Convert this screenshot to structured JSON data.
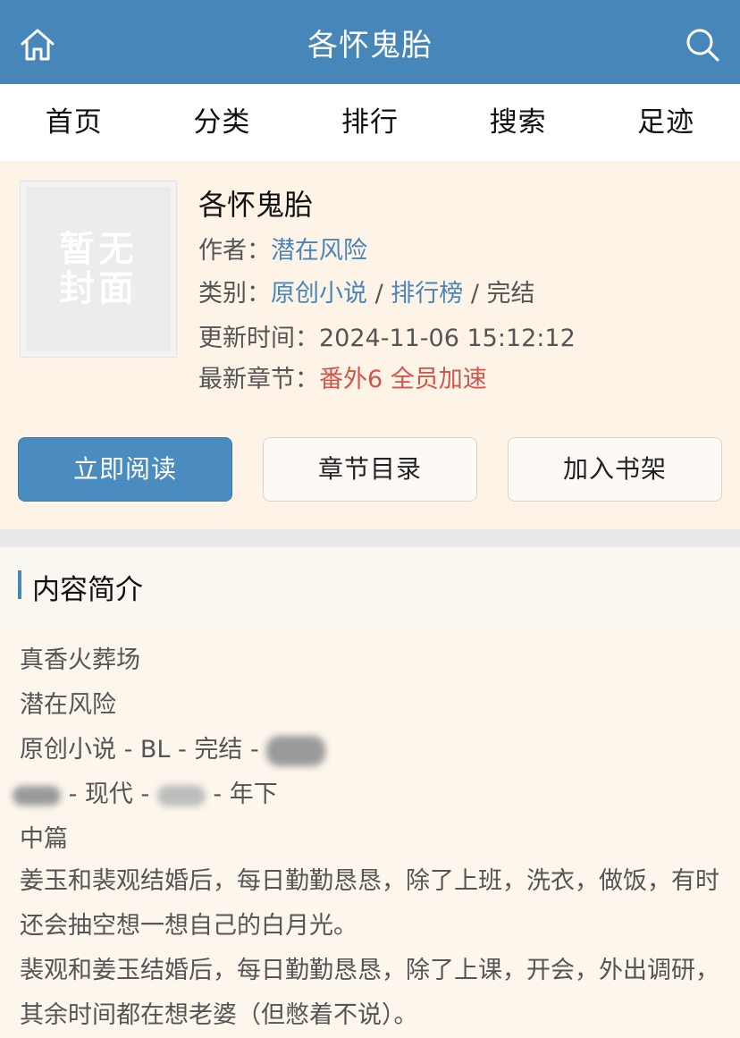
{
  "header": {
    "title": "各怀鬼胎",
    "home_icon": "home-icon",
    "search_icon": "search-icon",
    "color": "#4686b8"
  },
  "nav": {
    "items": [
      "首页",
      "分类",
      "排行",
      "搜索",
      "足迹"
    ]
  },
  "book": {
    "cover_placeholder": "暂无封面",
    "title": "各怀鬼胎",
    "author_label": "作者：",
    "author": "潜在风险",
    "category_label": "类别：",
    "category": "原创小说",
    "sep1": " / ",
    "ranking": "排行榜",
    "sep2": " / ",
    "status": "完结",
    "updated_label": "更新时间：",
    "updated": "2024-11-06 15:12:12",
    "latest_label": "最新章节：",
    "latest_chapter": "番外6 全员加速"
  },
  "actions": {
    "read": "立即阅读",
    "toc": "章节目录",
    "shelf": "加入书架"
  },
  "intro": {
    "heading": "内容简介",
    "line1": "真香火葬场",
    "line2": "潜在风险",
    "line3": "原创小说 - BL - 完结 -",
    "line4_mid": " - 现代 - ",
    "line4_end": " - 年下",
    "line5": "中篇",
    "para1": "姜玉和裴观结婚后，每日勤勤恳恳，除了上班，洗衣，做饭，有时还会抽空想一想自己的白月光。",
    "para2": "裴观和姜玉结婚后，每日勤勤恳恳，除了上课，开会，外出调研，其余时间都在想老婆（但憋着不说）。"
  }
}
